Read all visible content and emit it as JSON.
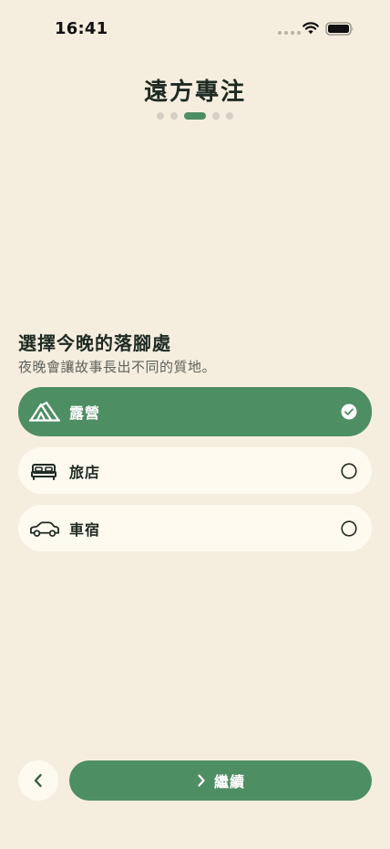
{
  "status_bar": {
    "time": "16:41"
  },
  "header": {
    "title": "遠方專注",
    "page_indicator": {
      "total": 5,
      "current": 3
    }
  },
  "section": {
    "title": "選擇今晚的落腳處",
    "subtitle": "夜晚會讓故事長出不同的質地。"
  },
  "options": [
    {
      "label": "露營",
      "icon": "tent-icon",
      "selected": true
    },
    {
      "label": "旅店",
      "icon": "bed-icon",
      "selected": false
    },
    {
      "label": "車宿",
      "icon": "car-icon",
      "selected": false
    }
  ],
  "footer": {
    "back_icon": "chevron-left-icon",
    "continue_label": "繼續",
    "continue_icon": "chevron-right-icon"
  },
  "colors": {
    "background": "#F5EEDF",
    "accent": "#4E8E63",
    "card": "#FFFAF0",
    "text": "#1E2A22",
    "muted": "#5E625B"
  }
}
